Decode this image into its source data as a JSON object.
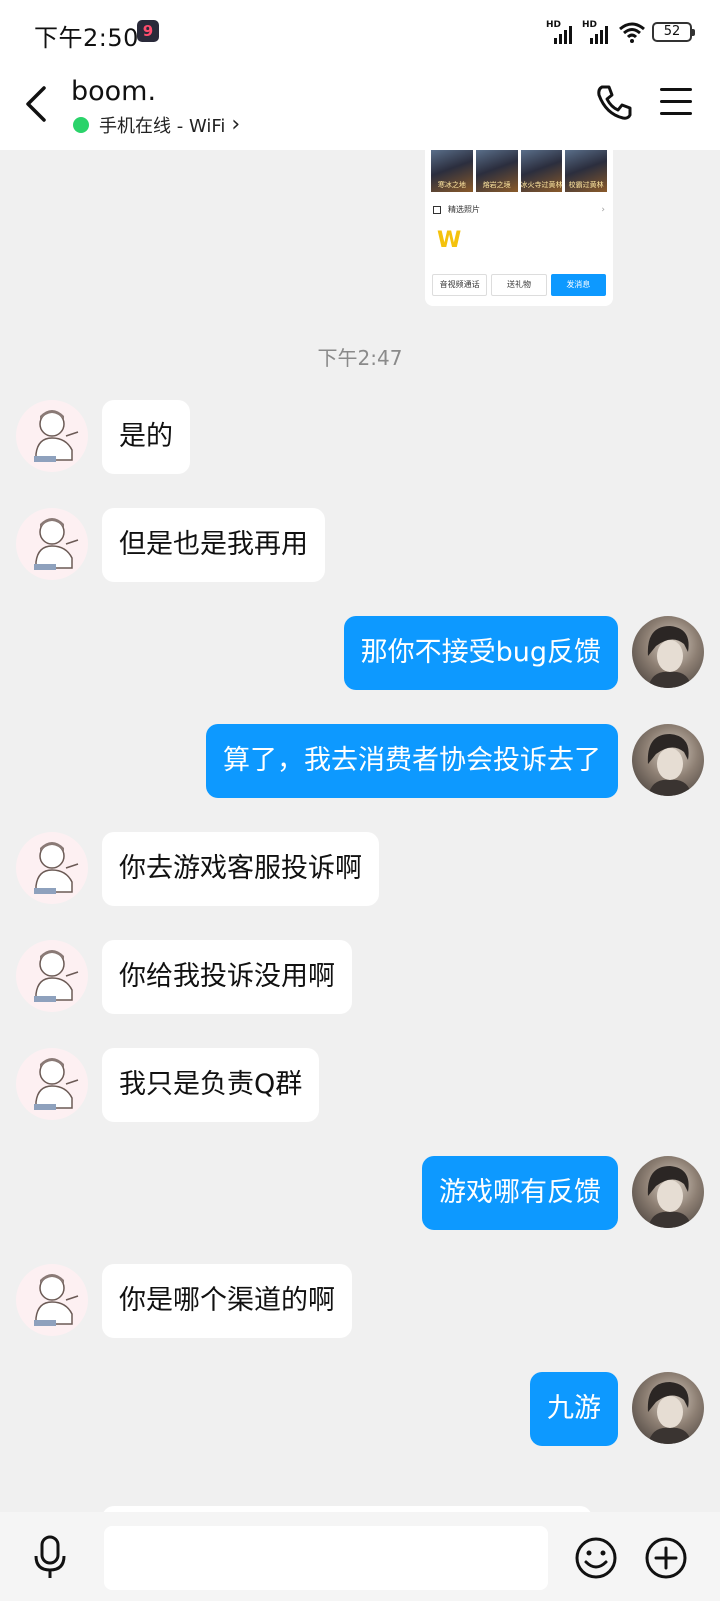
{
  "status_bar": {
    "time": "下午2:50",
    "app_icon": "9",
    "battery": "52"
  },
  "header": {
    "contact_name": "boom.",
    "status_text": "手机在线 - WiFi",
    "status_chevron": "›"
  },
  "share_card": {
    "images": [
      "寒冰之地",
      "熔岩之境",
      "冰火寺过黄林",
      "校霸过黄林"
    ],
    "section_label": "精选照片",
    "logo": "W",
    "buttons": [
      "音视频通话",
      "送礼物",
      "发消息"
    ]
  },
  "timestamp": "下午2:47",
  "messages": [
    {
      "side": "in",
      "text": "是的"
    },
    {
      "side": "in",
      "text": "但是也是我再用"
    },
    {
      "side": "out",
      "text": "那你不接受bug反馈"
    },
    {
      "side": "out",
      "text": "算了，我去消费者协会投诉去了"
    },
    {
      "side": "in",
      "text": "你去游戏客服投诉啊"
    },
    {
      "side": "in",
      "text": "你给我投诉没用啊"
    },
    {
      "side": "in",
      "text": "我只是负责Q群"
    },
    {
      "side": "out",
      "text": "游戏哪有反馈"
    },
    {
      "side": "in",
      "text": "你是哪个渠道的啊"
    },
    {
      "side": "out",
      "text": "九游"
    }
  ],
  "input": {
    "placeholder": ""
  },
  "colors": {
    "accent": "#0d99ff",
    "online": "#2ad36a",
    "background": "#f0f0f0"
  },
  "icons": [
    "back-chevron-icon",
    "phone-icon",
    "menu-icon",
    "mic-icon",
    "emoji-icon",
    "plus-icon"
  ]
}
